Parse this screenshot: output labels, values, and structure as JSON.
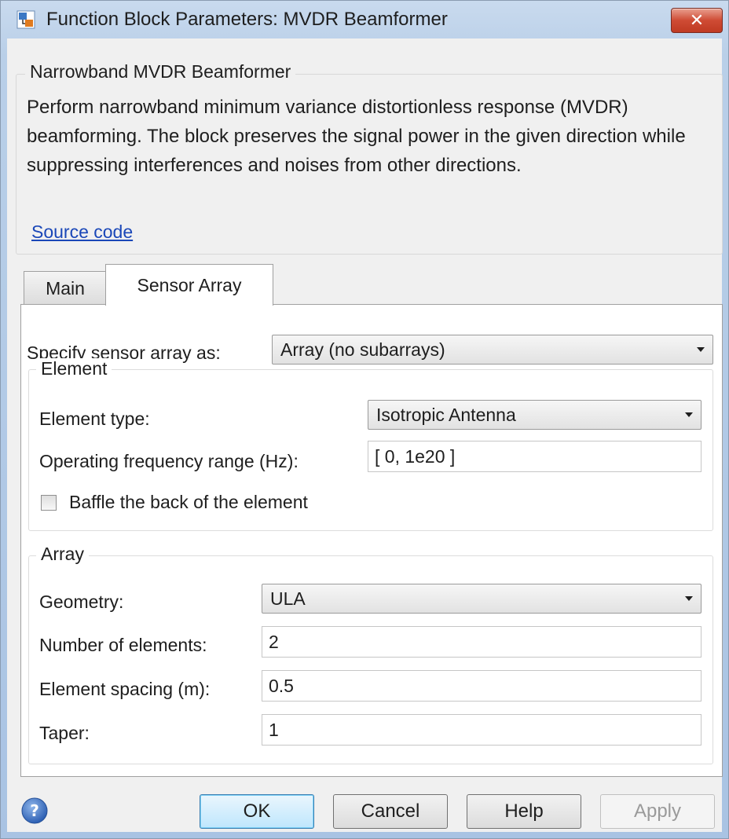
{
  "window": {
    "title": "Function Block Parameters: MVDR Beamformer",
    "close_glyph": "✕"
  },
  "description": {
    "group_title": "Narrowband MVDR Beamformer",
    "text": "Perform narrowband minimum variance distortionless response (MVDR) beamforming. The block preserves the signal power in the given direction while suppressing interferences and noises from other directions.",
    "source_link": "Source code"
  },
  "tabs": [
    {
      "label": "Main",
      "selected": false
    },
    {
      "label": "Sensor Array",
      "selected": true
    }
  ],
  "sensor_array": {
    "specify_label": "Specify sensor array as:",
    "specify_value": "Array (no subarrays)",
    "element": {
      "group_title": "Element",
      "type_label": "Element type:",
      "type_value": "Isotropic Antenna",
      "freq_label": "Operating frequency range (Hz):",
      "freq_value": "[ 0, 1e20 ]",
      "baffle_label": "Baffle the back of the element",
      "baffle_checked": false
    },
    "array": {
      "group_title": "Array",
      "geometry_label": "Geometry:",
      "geometry_value": "ULA",
      "num_label": "Number of elements:",
      "num_value": "2",
      "spacing_label": "Element spacing (m):",
      "spacing_value": "0.5",
      "taper_label": "Taper:",
      "taper_value": "1"
    }
  },
  "buttons": {
    "ok": "OK",
    "cancel": "Cancel",
    "help": "Help",
    "apply": "Apply"
  },
  "colors": {
    "link": "#1a47b8",
    "close_button": "#c84a33",
    "ok_border": "#3c7fb1"
  },
  "icons": {
    "window_icon": "simulink-block-icon",
    "help_icon": "help-question-icon"
  }
}
